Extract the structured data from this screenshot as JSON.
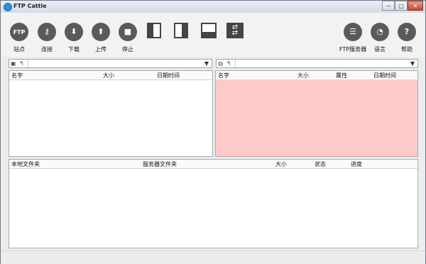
{
  "window": {
    "title": "FTP Cattle",
    "min": "−",
    "max": "□",
    "close": "✕"
  },
  "toolbar": {
    "site": {
      "icon": "FTP",
      "label": "站点"
    },
    "connect": {
      "icon": "⚷",
      "label": "连接"
    },
    "download": {
      "icon": "⬇",
      "label": "下载"
    },
    "upload": {
      "icon": "⬆",
      "label": "上传"
    },
    "stop": {
      "icon": "■",
      "label": "停止"
    },
    "ftp_server": {
      "icon": "☰",
      "label": "FTP服务器"
    },
    "language": {
      "icon": "◔",
      "label": "语言"
    },
    "help": {
      "icon": "?",
      "label": "帮助"
    }
  },
  "local_path": {
    "value": ""
  },
  "remote_path": {
    "value": ""
  },
  "local_list": {
    "columns": [
      "名字",
      "大小",
      "日期时间"
    ]
  },
  "remote_list": {
    "columns": [
      "名字",
      "大小",
      "属性",
      "日期时间"
    ],
    "highlight_color": "#fec9c9"
  },
  "transfer_list": {
    "columns": [
      "本地文件夹",
      "服务器文件夹",
      "大小",
      "状态",
      "进度"
    ]
  }
}
